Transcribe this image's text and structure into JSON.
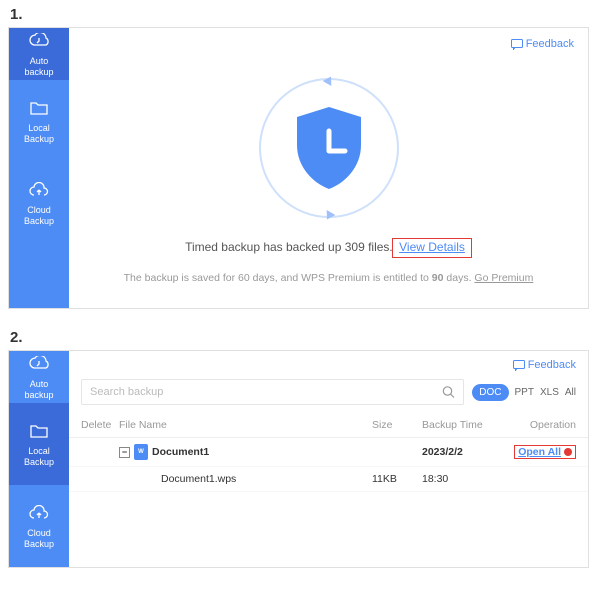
{
  "steps": {
    "one": "1.",
    "two": "2."
  },
  "feedback_label": "Feedback",
  "sidebar": {
    "items": [
      {
        "label_a": "Auto",
        "label_b": "backup"
      },
      {
        "label_a": "Local",
        "label_b": "Backup"
      },
      {
        "label_a": "Cloud",
        "label_b": "Backup"
      }
    ]
  },
  "status": {
    "prefix": "Timed backup has backed up ",
    "count": "309",
    "suffix": " files.",
    "link": "View Details"
  },
  "subline": {
    "t1": "The backup is saved for 60 days, and WPS Premium is entitled to ",
    "bold": "90",
    "t2": " days. ",
    "link": "Go Premium"
  },
  "search": {
    "placeholder": "Search backup"
  },
  "filters": {
    "doc": "DOC",
    "ppt": "PPT",
    "xls": "XLS",
    "all": "All"
  },
  "headers": {
    "del": "Delete",
    "name": "File Name",
    "size": "Size",
    "time": "Backup Time",
    "op": "Operation"
  },
  "row_main": {
    "name": "Document1",
    "time": "2023/2/2",
    "op": "Open All"
  },
  "row_sub": {
    "name": "Document1.wps",
    "size": "11KB",
    "time": "18:30"
  }
}
